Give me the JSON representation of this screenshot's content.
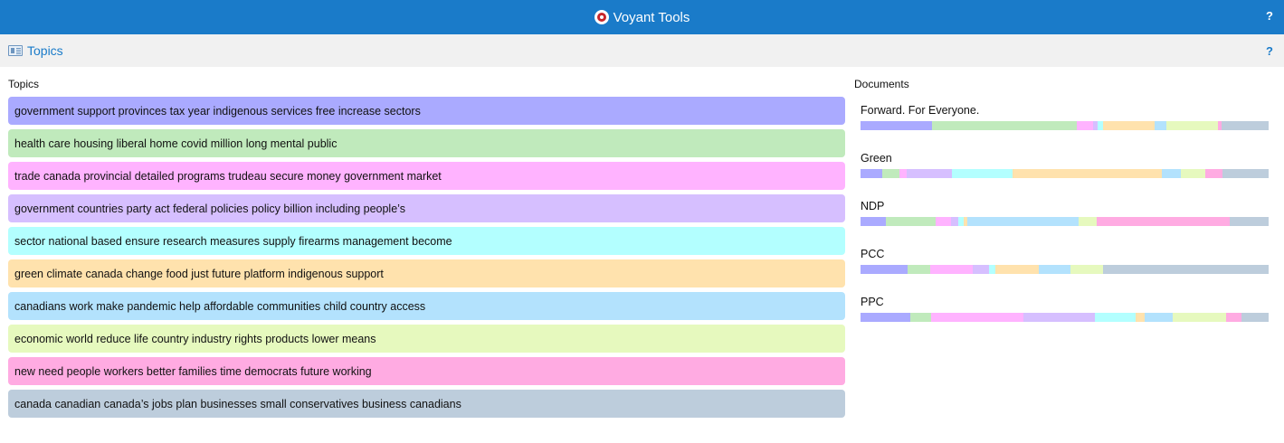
{
  "app": {
    "title": "Voyant Tools",
    "logo_icon": "voyant-logo-icon",
    "help_label": "?"
  },
  "panel": {
    "title": "Topics",
    "icon": "panel-icon",
    "help_label": "?"
  },
  "topics_header": "Topics",
  "documents_header": "Documents",
  "topics": [
    {
      "label": "government support provinces tax year indigenous services free increase sectors",
      "color": "#aaaaff"
    },
    {
      "label": "health care housing liberal home covid million long mental public",
      "color": "#c0eabc"
    },
    {
      "label": "trade canada provincial detailed programs trudeau secure money government market",
      "color": "#ffb3ff"
    },
    {
      "label": "government countries party act federal policies policy billion including people’s",
      "color": "#d6bfff"
    },
    {
      "label": "sector national based ensure research measures supply firearms management become",
      "color": "#b3ffff"
    },
    {
      "label": "green climate canada change food just future platform indigenous support",
      "color": "#ffe2ad"
    },
    {
      "label": "canadians work make pandemic help affordable communities child country access",
      "color": "#b3e2fd"
    },
    {
      "label": "economic world reduce life country industry rights products lower means",
      "color": "#e6f9be"
    },
    {
      "label": "new need people workers better families time democrats future working",
      "color": "#ffabe2"
    },
    {
      "label": "canada canadian canada’s jobs plan businesses small conservatives business canadians",
      "color": "#bdcddc"
    }
  ],
  "documents": [
    {
      "label": "Forward. For Everyone.",
      "proportions": [
        0.175,
        0.355,
        0.04,
        0.01,
        0.015,
        0.125,
        0.03,
        0.125,
        0.01,
        0.115
      ]
    },
    {
      "label": "Green",
      "proportions": [
        0.053,
        0.042,
        0.018,
        0.11,
        0.15,
        0.365,
        0.048,
        0.058,
        0.043,
        0.113
      ]
    },
    {
      "label": "NDP",
      "proportions": [
        0.062,
        0.122,
        0.038,
        0.018,
        0.012,
        0.01,
        0.272,
        0.045,
        0.325,
        0.096
      ]
    },
    {
      "label": "PCC",
      "proportions": [
        0.115,
        0.055,
        0.105,
        0.04,
        0.015,
        0.107,
        0.078,
        0.08,
        0.0,
        0.405
      ]
    },
    {
      "label": "PPC",
      "proportions": [
        0.122,
        0.05,
        0.228,
        0.175,
        0.1,
        0.022,
        0.068,
        0.13,
        0.038,
        0.067
      ]
    }
  ],
  "document_bar_order": [
    0,
    1,
    7,
    2,
    4,
    5,
    6,
    7,
    8,
    9
  ]
}
